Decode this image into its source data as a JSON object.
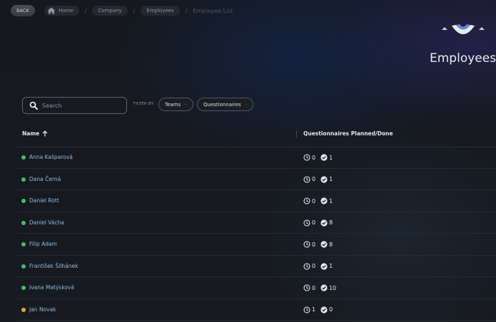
{
  "topbar": {
    "back_label": "BACK",
    "breadcrumbs": [
      "Home",
      "Company",
      "Employees"
    ],
    "current": "Employee List"
  },
  "header": {
    "title": "Employees"
  },
  "filters": {
    "search_placeholder": "Search",
    "filter_by_label": "FILTER BY:",
    "teams_label": "Teams",
    "questionnaires_label": "Questionnaires"
  },
  "table": {
    "col_name": "Name",
    "col_questionnaires": "Questionnaires Planned/Done",
    "rows": [
      {
        "name": "Anna Kašparová",
        "status": "green",
        "planned": "0",
        "done": "1"
      },
      {
        "name": "Dana Černá",
        "status": "green",
        "planned": "0",
        "done": "1"
      },
      {
        "name": "Daniel Rott",
        "status": "green",
        "planned": "0",
        "done": "1"
      },
      {
        "name": "Daniel Vácha",
        "status": "green",
        "planned": "0",
        "done": "8"
      },
      {
        "name": "Filip Adam",
        "status": "green",
        "planned": "0",
        "done": "8"
      },
      {
        "name": "František Šilhánek",
        "status": "green",
        "planned": "0",
        "done": "1"
      },
      {
        "name": "Ivana Matýsková",
        "status": "green",
        "planned": "0",
        "done": "10"
      },
      {
        "name": "Jan Novak",
        "status": "orange",
        "planned": "1",
        "done": "0"
      }
    ]
  },
  "colors": {
    "green": "#3fbf63",
    "orange": "#e8a33c",
    "link": "#8fb8e0",
    "background": "#16191f"
  },
  "icons": [
    "home-icon",
    "search-icon",
    "chevron-down-icon",
    "sort-arrow-up-icon",
    "clock-icon",
    "check-circle-icon",
    "logo-icon"
  ]
}
